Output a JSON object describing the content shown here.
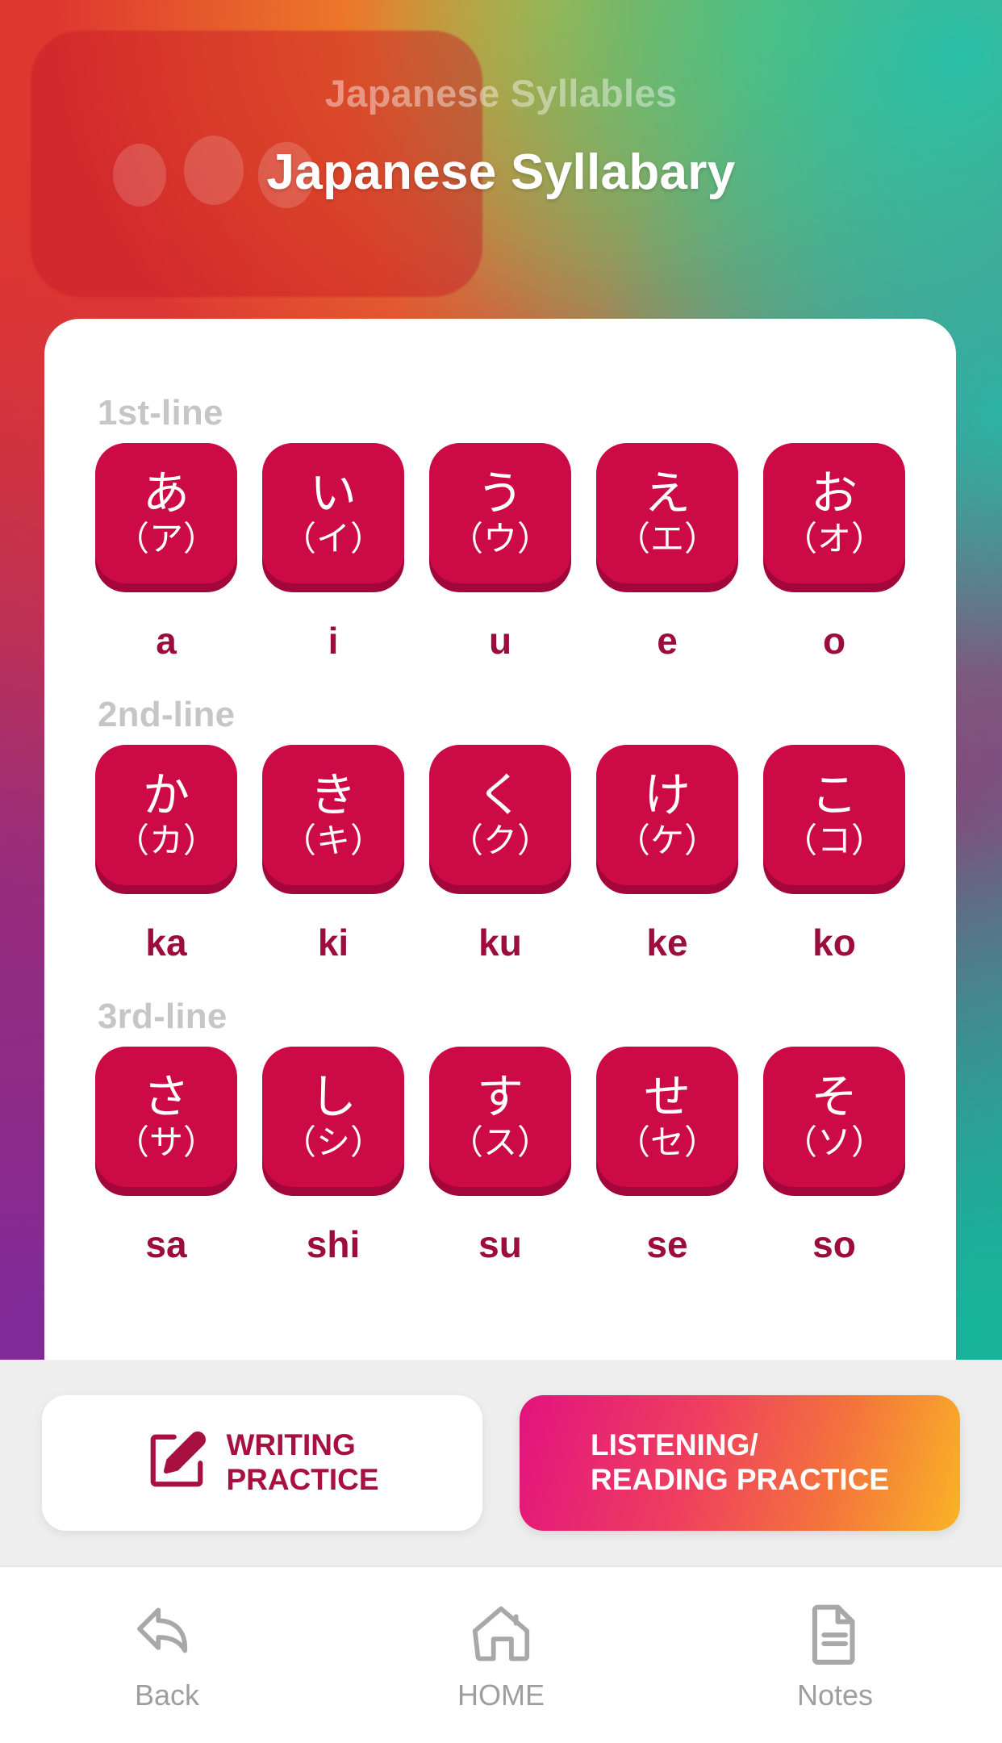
{
  "header": {
    "subtitle": "Japanese Syllables",
    "title": "Japanese Syllabary"
  },
  "colors": {
    "tile": "#CC0A46",
    "tile_edge": "#A3063A",
    "romaji": "#9C0C3C",
    "row_label": "#C6C6C6",
    "writing_accent": "#A8103F",
    "listening_gradient_start": "#E2137F",
    "listening_gradient_end": "#F9B326",
    "nav_gray": "#A8A8A8"
  },
  "rows": [
    {
      "label": "1st-line",
      "cells": [
        {
          "hiragana": "あ",
          "katakana": "（ア）",
          "romaji": "a"
        },
        {
          "hiragana": "い",
          "katakana": "（イ）",
          "romaji": "i"
        },
        {
          "hiragana": "う",
          "katakana": "（ウ）",
          "romaji": "u"
        },
        {
          "hiragana": "え",
          "katakana": "（エ）",
          "romaji": "e"
        },
        {
          "hiragana": "お",
          "katakana": "（オ）",
          "romaji": "o"
        }
      ]
    },
    {
      "label": "2nd-line",
      "cells": [
        {
          "hiragana": "か",
          "katakana": "（カ）",
          "romaji": "ka"
        },
        {
          "hiragana": "き",
          "katakana": "（キ）",
          "romaji": "ki"
        },
        {
          "hiragana": "く",
          "katakana": "（ク）",
          "romaji": "ku"
        },
        {
          "hiragana": "け",
          "katakana": "（ケ）",
          "romaji": "ke"
        },
        {
          "hiragana": "こ",
          "katakana": "（コ）",
          "romaji": "ko"
        }
      ]
    },
    {
      "label": "3rd-line",
      "cells": [
        {
          "hiragana": "さ",
          "katakana": "（サ）",
          "romaji": "sa"
        },
        {
          "hiragana": "し",
          "katakana": "（シ）",
          "romaji": "shi"
        },
        {
          "hiragana": "す",
          "katakana": "（ス）",
          "romaji": "su"
        },
        {
          "hiragana": "せ",
          "katakana": "（セ）",
          "romaji": "se"
        },
        {
          "hiragana": "そ",
          "katakana": "（ソ）",
          "romaji": "so"
        }
      ]
    }
  ],
  "actions": {
    "writing": {
      "line1": "WRITING",
      "line2": "PRACTICE",
      "icon": "pencil-square-icon"
    },
    "listening": {
      "line1": "LISTENING/",
      "line2": "READING PRACTICE"
    }
  },
  "bottom_nav": [
    {
      "label": "Back",
      "icon": "back-arrow-icon"
    },
    {
      "label": "HOME",
      "icon": "home-icon"
    },
    {
      "label": "Notes",
      "icon": "notes-document-icon"
    }
  ]
}
